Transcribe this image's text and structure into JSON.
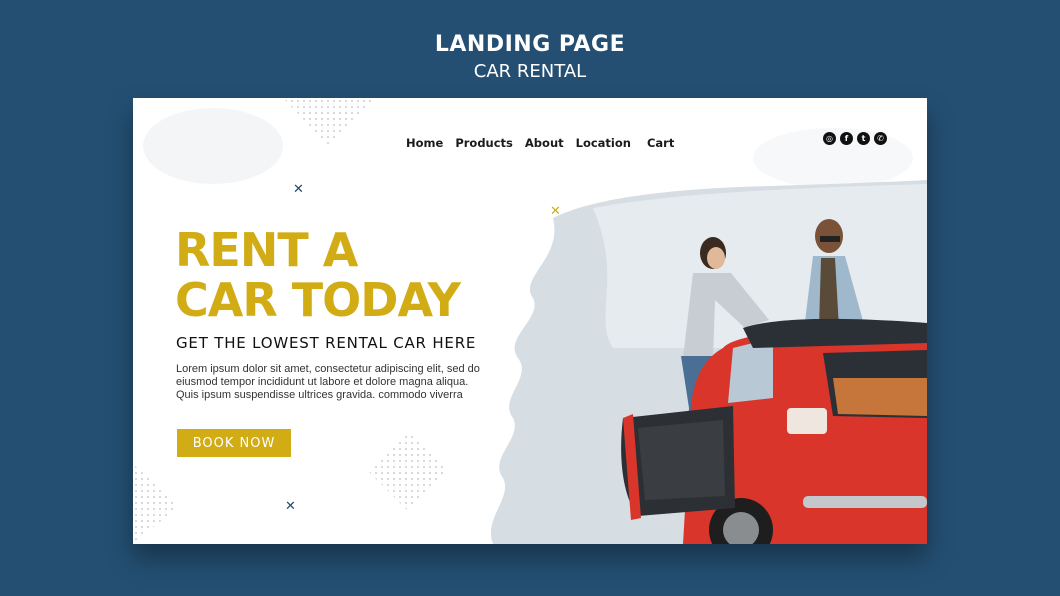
{
  "showcase": {
    "title": "LANDING PAGE",
    "subtitle": "CAR RENTAL"
  },
  "nav": {
    "items": [
      "Home",
      "Products",
      "About",
      "Location",
      "Cart"
    ]
  },
  "social": [
    "instagram-icon",
    "facebook-icon",
    "twitter-icon",
    "whatsapp-icon"
  ],
  "hero": {
    "headline_line1": "RENT A",
    "headline_line2": "CAR TODAY",
    "subheadline": "GET THE LOWEST RENTAL CAR HERE",
    "body_line1": "Lorem ipsum dolor sit amet, consectetur adipiscing elit, sed do",
    "body_line2": "eiusmod tempor incididunt ut labore et dolore magna aliqua.",
    "body_line3": "Quis ipsum suspendisse ultrices gravida. commodo viverra",
    "cta_label": "BOOK NOW"
  },
  "colors": {
    "background": "#244f72",
    "accent": "#d1ac14",
    "car": "#d9352a"
  }
}
